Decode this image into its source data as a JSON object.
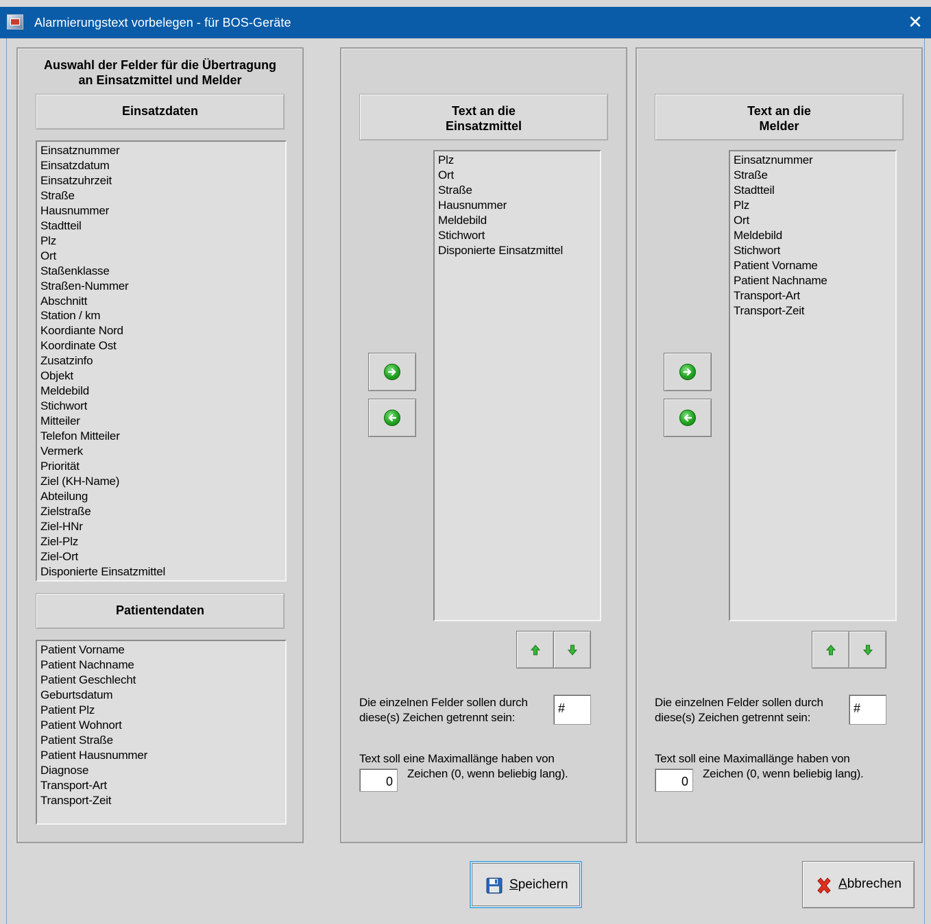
{
  "window": {
    "title": "Alarmierungstext vorbelegen - für BOS-Geräte",
    "close_glyph": "✕"
  },
  "left": {
    "heading": "Auswahl der Felder für die Übertragung an Einsatzmittel und Melder",
    "heading_line1": "Auswahl der Felder für die Übertragung",
    "heading_line2": "an Einsatzmittel und Melder",
    "einsatz_header": "Einsatzdaten",
    "einsatz_items": [
      "Einsatznummer",
      "Einsatzdatum",
      "Einsatzuhrzeit",
      "Straße",
      "Hausnummer",
      "Stadtteil",
      "Plz",
      "Ort",
      "Staßenklasse",
      "Straßen-Nummer",
      "Abschnitt",
      "Station / km",
      "Koordiante Nord",
      "Koordinate Ost",
      "Zusatzinfo",
      "Objekt",
      "Meldebild",
      "Stichwort",
      "Mitteiler",
      "Telefon Mitteiler",
      "Vermerk",
      "Priorität",
      "Ziel (KH-Name)",
      "Abteilung",
      "Zielstraße",
      "Ziel-HNr",
      "Ziel-Plz",
      "Ziel-Ort",
      "Disponierte Einsatzmittel"
    ],
    "patient_header": "Patientendaten",
    "patient_items": [
      "Patient Vorname",
      "Patient Nachname",
      "Patient Geschlecht",
      "Geburtsdatum",
      "Patient Plz",
      "Patient Wohnort",
      "Patient Straße",
      "Patient Hausnummer",
      "Diagnose",
      "Transport-Art",
      "Transport-Zeit"
    ]
  },
  "einsatzmittel": {
    "header_line1": "Text an die",
    "header_line2": "Einsatzmittel",
    "items": [
      "Plz",
      "Ort",
      "Straße",
      "Hausnummer",
      "Meldebild",
      "Stichwort",
      "Disponierte Einsatzmittel"
    ],
    "separator_label_line1": "Die einzelnen Felder sollen durch",
    "separator_label_line2": "diese(s) Zeichen getrennt sein:",
    "separator_value": "#",
    "maxlen_label_line1": "Text soll eine Maximallänge haben von",
    "maxlen_label_line2": "Zeichen (0, wenn beliebig lang).",
    "maxlen_value": "0"
  },
  "melder": {
    "header_line1": "Text an die",
    "header_line2": "Melder",
    "items": [
      "Einsatznummer",
      "Straße",
      "Stadtteil",
      "Plz",
      "Ort",
      "Meldebild",
      "Stichwort",
      "Patient Vorname",
      "Patient Nachname",
      "Transport-Art",
      "Transport-Zeit"
    ],
    "separator_label_line1": "Die einzelnen Felder sollen durch",
    "separator_label_line2": "diese(s) Zeichen getrennt sein:",
    "separator_value": "#",
    "maxlen_label_line1": "Text soll eine Maximallänge haben von",
    "maxlen_label_line2": "Zeichen (0, wenn beliebig lang).",
    "maxlen_value": "0"
  },
  "buttons": {
    "save_underlined": "S",
    "save_rest": "peichern",
    "cancel_underlined": "A",
    "cancel_rest": "bbrechen"
  },
  "colors": {
    "titlebar": "#0a5ca8",
    "arrow_green": "#22a322",
    "cancel_red": "#e0301e",
    "save_blue": "#2b66b8"
  },
  "icons": {
    "add": "arrow-right-green-icon",
    "remove": "arrow-left-green-icon",
    "up": "arrow-up-green-icon",
    "down": "arrow-down-green-icon",
    "save": "floppy-disk-icon",
    "cancel": "red-x-icon"
  }
}
